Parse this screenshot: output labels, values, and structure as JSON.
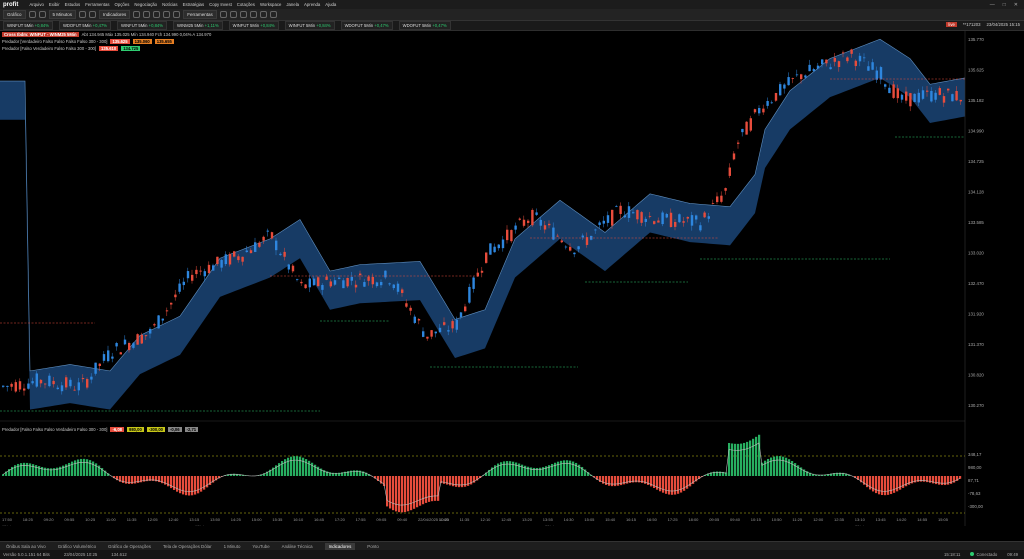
{
  "menubar": {
    "logo": "profit",
    "items": [
      "Arquivo",
      "Exibir",
      "Estudos",
      "Ferramentas",
      "Opções",
      "Negociação",
      "Notícias",
      "Estratégias",
      "Copy Invest",
      "Cotações",
      "Workspace",
      "Janela",
      "Aprenda",
      "Ajuda"
    ]
  },
  "toolbar": {
    "chart_label": "Gráfico",
    "interval_label": "5 Minutos",
    "indicators_label": "Indicadores",
    "tools_label": "Ferramentas"
  },
  "quotes": [
    {
      "symbol": "WINFUT 5Min",
      "pct": "+0,84%"
    },
    {
      "symbol": "WDOFUT 5Min",
      "pct": "+0,47%"
    },
    {
      "symbol": "WINFUT 5Min",
      "pct": "+0,84%"
    },
    {
      "symbol": "WINM25 5Min",
      "pct": "+1,11%"
    },
    {
      "symbol": "WINFUT 5Min",
      "pct": "+0,84%"
    },
    {
      "symbol": "WINFUT 5Min",
      "pct": "+0,84%"
    },
    {
      "symbol": "WDOFUT 5Min",
      "pct": "+0,47%"
    },
    {
      "symbol": "WDOFUT 5Min",
      "pct": "+0,47%"
    }
  ],
  "status_right": {
    "live": "live",
    "code": "**171203",
    "datetime": "23/04/2025 15:15"
  },
  "chart_header": {
    "symbol": "Cross Ibdm: WINFUT - WINM25 5Min",
    "ohlc": "Abt 134.945  Máx 135.025  Mín 134.940  Fch 134.990  0,04%  A 134.970",
    "line2_label": "Predador [Verdadeiro Falso Falso Falso Falso 300 - 300]",
    "line2_vals": [
      "135.625",
      "135.060",
      "135.655"
    ],
    "line3_label": "Predador [Falso Verdadeiro Falso Falso 300 - 300]",
    "line3_vals": [
      "135.610",
      "134.725"
    ]
  },
  "indicator_label": "Predador [Falso Falso Falso Verdadeiro Falso 300 - 300]",
  "indicator_vals": [
    "-6,08",
    "980,00",
    "-300,00",
    "-0,06",
    "-2,71"
  ],
  "price_axis": [
    "135.770",
    "135.625",
    "135.182",
    "134.990",
    "134.725",
    "134.128",
    "133.585",
    "133.020",
    "132.470",
    "131.920",
    "131.370",
    "130.820",
    "130.270"
  ],
  "indicator_axis": [
    "348,17",
    "980,00",
    "87,71",
    "-78,63",
    "-300,00"
  ],
  "time_axis": [
    "17:50",
    "18:25",
    "09:20",
    "09:55",
    "10:25",
    "11:00",
    "11:35",
    "12:05",
    "12:40",
    "13:15",
    "13:50",
    "14:25",
    "15:00",
    "15:35",
    "16:10",
    "16:45",
    "17:20",
    "17:55",
    "09:05",
    "09:40",
    "22/04/2025 10:25",
    "11:00",
    "11:35",
    "12:10",
    "12:45",
    "13:20",
    "13:55",
    "14:30",
    "15:05",
    "15:40",
    "16:15",
    "16:50",
    "17:25",
    "18:00",
    "09:05",
    "09:40",
    "10:15",
    "10:50",
    "11:25",
    "12:00",
    "12:35",
    "13:10",
    "13:45",
    "14:20",
    "14:55",
    "15:05"
  ],
  "date_labels": [
    "15/abr",
    "17/abr",
    "22/abr",
    "23/abr"
  ],
  "bottom_tabs": [
    "Ônibus Sala ao Vivo",
    "Gráfico Volumétrico",
    "Gráfico de Operações",
    "Tela de Operações Dólar",
    "1 Minuto",
    "YouTube",
    "Análise Técnica",
    "Indicadores",
    "Ponto"
  ],
  "active_tab": "Indicadores",
  "statusbar": {
    "version": "Versão 5.0.1.151 64 Bits",
    "date": "23/04/2025 10:25",
    "value": "134.612",
    "time": "15:18:11",
    "connection": "Conectado",
    "clock": "09:49"
  },
  "colors": {
    "bull": "#2e86de",
    "bear": "#e74c3c",
    "band": "#1f4f87",
    "hist_up": "#27ae60",
    "hist_dn": "#e74c3c",
    "support": "#2ecc71",
    "resistance": "#e74c3c"
  }
}
